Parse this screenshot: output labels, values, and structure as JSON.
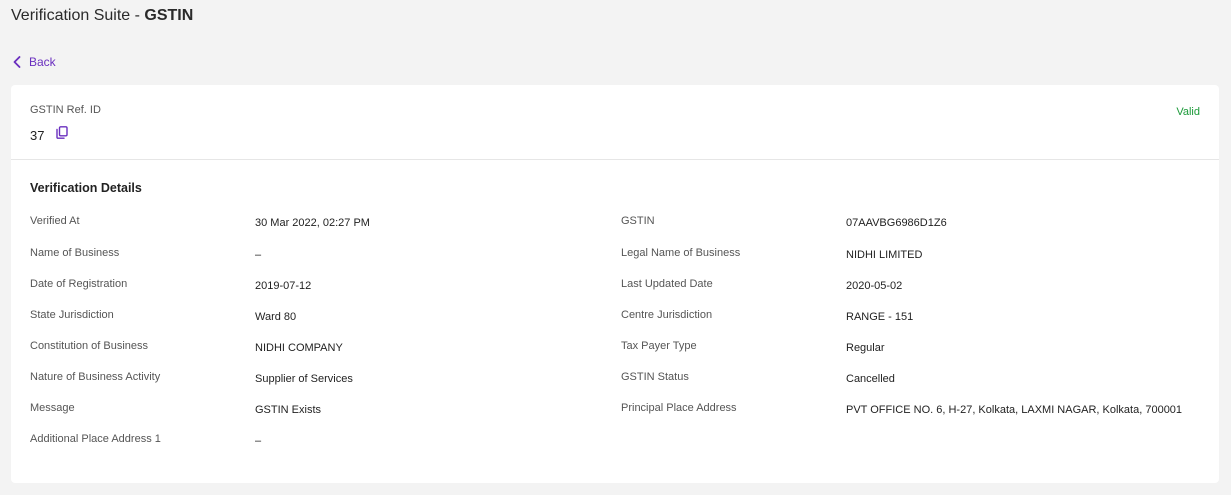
{
  "header": {
    "title_prefix": "Verification Suite - ",
    "title_bold": "GSTIN"
  },
  "nav": {
    "back_label": "Back"
  },
  "reference": {
    "label": "GSTIN Ref. ID",
    "value": "37",
    "status": "Valid",
    "status_color": "#1c9a3a"
  },
  "details": {
    "title": "Verification Details",
    "left": [
      {
        "label": "Verified At",
        "value": "30 Mar 2022, 02:27 PM"
      },
      {
        "label": "Name of Business",
        "value": "–"
      },
      {
        "label": "Date of Registration",
        "value": "2019-07-12"
      },
      {
        "label": "State Jurisdiction",
        "value": "Ward 80"
      },
      {
        "label": "Constitution of Business",
        "value": "NIDHI COMPANY"
      },
      {
        "label": "Nature of Business Activity",
        "value": "Supplier of Services"
      },
      {
        "label": "Message",
        "value": "GSTIN Exists"
      },
      {
        "label": "Additional Place Address 1",
        "value": "–"
      }
    ],
    "right": [
      {
        "label": "GSTIN",
        "value": "07AAVBG6986D1Z6"
      },
      {
        "label": "Legal Name of Business",
        "value": "NIDHI LIMITED"
      },
      {
        "label": "Last Updated Date",
        "value": "2020-05-02"
      },
      {
        "label": "Centre Jurisdiction",
        "value": "RANGE - 151"
      },
      {
        "label": "Tax Payer Type",
        "value": "Regular"
      },
      {
        "label": "GSTIN Status",
        "value": "Cancelled"
      },
      {
        "label": "Principal Place Address",
        "value": "PVT OFFICE NO. 6, H-27, Kolkata, LAXMI NAGAR, Kolkata, 700001"
      }
    ]
  },
  "icons": {
    "back": "chevron-left-icon",
    "copy": "copy-icon"
  },
  "colors": {
    "accent": "#6a2fbf",
    "valid": "#1c9a3a",
    "background": "#f3f3f3",
    "card": "#ffffff"
  }
}
